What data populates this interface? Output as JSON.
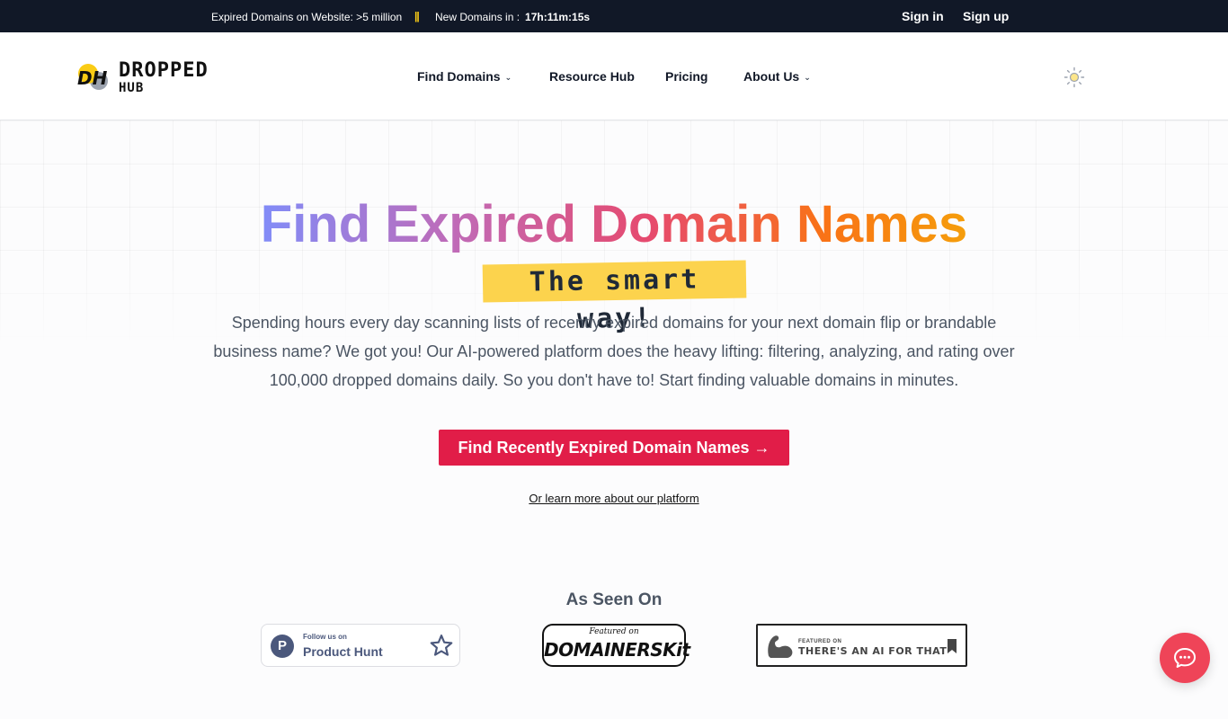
{
  "topbar": {
    "stat_expired": "Expired Domains on Website: >5 million",
    "separator": "||",
    "stat_new_label": "New Domains in :",
    "stat_new_countdown": "17h:11m:15s",
    "signin_label": "Sign in",
    "signup_label": "Sign up"
  },
  "header": {
    "logo_mark": "DH",
    "logo_word1": "DROPPED",
    "logo_word2": "HUB",
    "nav": {
      "find_domains": "Find Domains",
      "resource_hub": "Resource Hub",
      "pricing": "Pricing",
      "about_us": "About Us"
    },
    "theme_icon": "sun-icon"
  },
  "hero": {
    "title": "Find Expired Domain Names",
    "highlight": "The smart way!",
    "description": "Spending hours every day scanning lists of recently expired domains for your next domain flip or brandable business name? We got you! Our AI-powered platform does the heavy lifting: filtering, analyzing, and rating over 100,000 dropped domains daily. So you don't have to! Start finding valuable domains in minutes.",
    "cta_label": "Find Recently Expired Domain Names →",
    "learn_more": "Or learn more about our platform"
  },
  "as_seen_on": {
    "heading": "As Seen On",
    "producthunt": {
      "follow": "Follow us on",
      "name": "Product Hunt",
      "letter": "P"
    },
    "domainerskit": {
      "featured": "Featured on",
      "name": "DOMAINERSKit"
    },
    "aiforthat": {
      "featured": "FEATURED ON",
      "name": "THERE'S AN AI FOR THAT"
    }
  },
  "chat_icon": "chat-bubble-icon",
  "colors": {
    "topbar_bg": "#111827",
    "cta": "#e11d48",
    "highlight": "#fcd34d",
    "chat": "#ef4458"
  }
}
